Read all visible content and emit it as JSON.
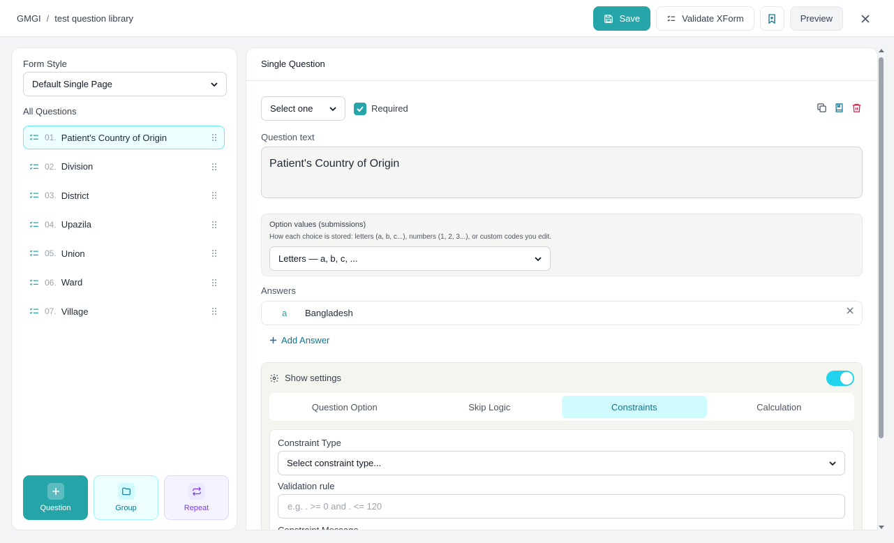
{
  "breadcrumb": {
    "org": "GMGI",
    "separator": "/",
    "library": "test question library"
  },
  "toolbar": {
    "save_label": "Save",
    "validate_label": "Validate XForm",
    "preview_label": "Preview"
  },
  "sidebar": {
    "form_style_label": "Form Style",
    "form_style_value": "Default Single Page",
    "all_questions_label": "All Questions",
    "questions": [
      {
        "num": "01.",
        "label": "Patient's Country of Origin"
      },
      {
        "num": "02.",
        "label": "Division"
      },
      {
        "num": "03.",
        "label": "District"
      },
      {
        "num": "04.",
        "label": "Upazila"
      },
      {
        "num": "05.",
        "label": "Union"
      },
      {
        "num": "06.",
        "label": "Ward"
      },
      {
        "num": "07.",
        "label": "Village"
      }
    ],
    "add_buttons": {
      "question": "Question",
      "group": "Group",
      "repeat": "Repeat"
    }
  },
  "editor": {
    "title": "Single Question",
    "type_value": "Select one",
    "required_label": "Required",
    "required_checked": true,
    "question_text_label": "Question text",
    "question_text": "Patient's Country of Origin",
    "option_values": {
      "title": "Option values (submissions)",
      "help": "How each choice is stored: letters (a, b, c...), numbers (1, 2, 3...), or custom codes you edit.",
      "value": "Letters — a, b, c, ..."
    },
    "answers_label": "Answers",
    "answers": [
      {
        "code": "a",
        "label": "Bangladesh"
      }
    ],
    "add_answer_label": "Add Answer",
    "settings": {
      "label": "Show settings",
      "enabled": true,
      "tabs": [
        "Question Option",
        "Skip Logic",
        "Constraints",
        "Calculation"
      ],
      "active_tab": "Constraints",
      "constraint_type_label": "Constraint Type",
      "constraint_type_placeholder": "Select constraint type...",
      "validation_rule_label": "Validation rule",
      "validation_rule_placeholder": "e.g. . >= 0 and . <= 120",
      "constraint_message_label": "Constraint Message"
    }
  },
  "colors": {
    "accent": "#26a5a8",
    "active_item_bg": "#ecfeff",
    "danger": "#e11d48",
    "toggle": "#22d3ee"
  },
  "icons": {
    "save": "save-icon",
    "validate": "checklist-icon",
    "bookmark": "bookmark-plus-icon",
    "close": "close-icon",
    "question_type": "list-check-icon",
    "drag": "drag-handle-icon",
    "copy": "copy-icon",
    "save_to_library": "book-icon",
    "delete": "trash-icon",
    "settings": "gear-icon"
  }
}
